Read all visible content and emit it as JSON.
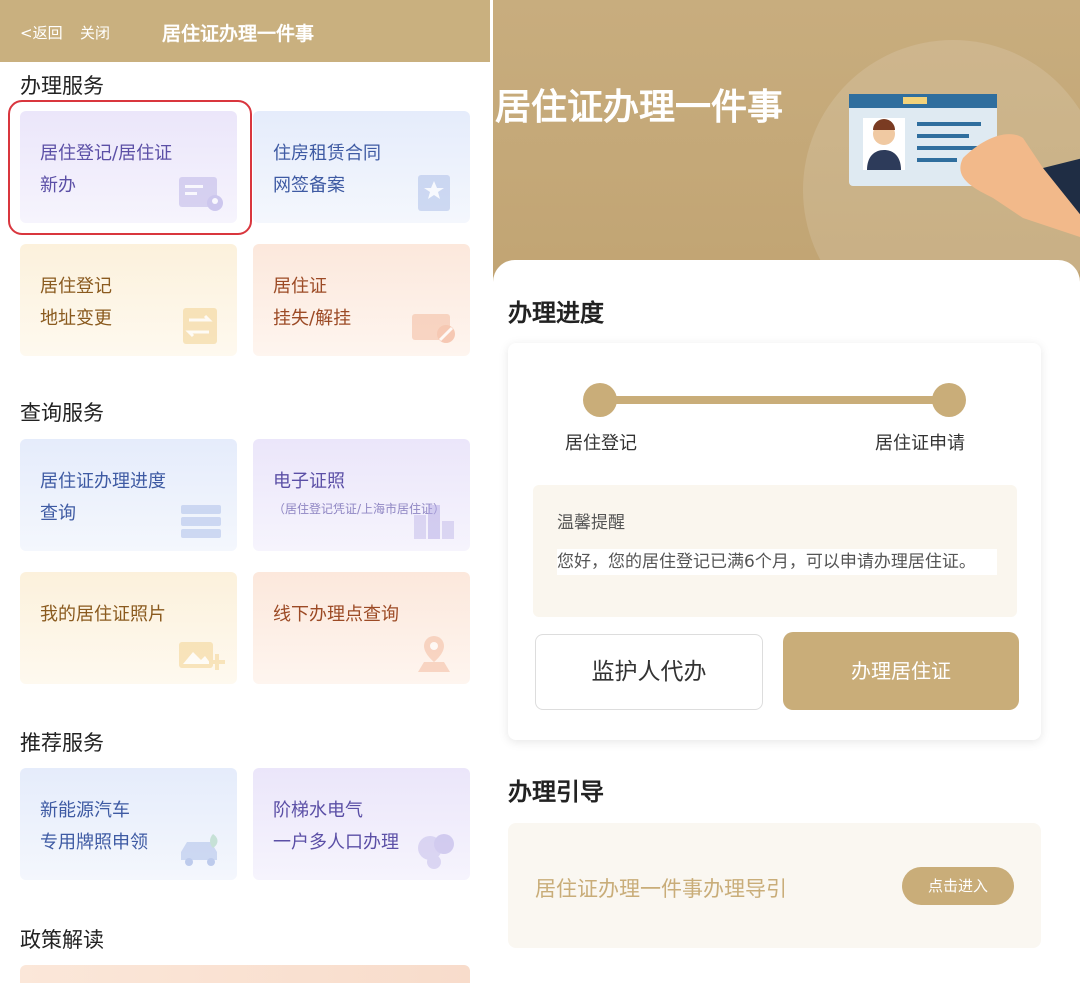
{
  "left": {
    "topbar": {
      "back": "<返回",
      "close": "关闭",
      "title": "居住证办理一件事"
    },
    "sections": {
      "handle": "办理服务",
      "query": "查询服务",
      "recommend": "推荐服务",
      "policy": "政策解读"
    },
    "cards": {
      "reg_new": {
        "l1": "居住登记/居住证",
        "l2": "新办",
        "icon": "id-card-icon"
      },
      "rental": {
        "l1": "住房租赁合同",
        "l2": "网签备案",
        "icon": "star-document-icon"
      },
      "address": {
        "l1": "居住登记",
        "l2": "地址变更",
        "icon": "swap-document-icon"
      },
      "lost": {
        "l1": "居住证",
        "l2": "挂失/解挂",
        "icon": "card-block-icon"
      },
      "progress_query": {
        "l1": "居住证办理进度",
        "l2": "查询",
        "icon": "list-icon"
      },
      "e_license": {
        "l1": "电子证照",
        "sub": "（居住登记凭证/上海市居住证）",
        "icon": "chart-icon"
      },
      "photo": {
        "l1": "我的居住证照片",
        "icon": "photo-add-icon"
      },
      "offline": {
        "l1": "线下办理点查询",
        "icon": "location-pin-icon"
      },
      "ev_plate": {
        "l1": "新能源汽车",
        "l2": "专用牌照申领",
        "icon": "car-icon"
      },
      "utility": {
        "l1": "阶梯水电气",
        "l2": "一户多人口办理",
        "icon": "water-drop-icon"
      }
    }
  },
  "right": {
    "banner_title": "居住证办理一件事",
    "progress": {
      "heading": "办理进度",
      "step1": "居住登记",
      "step2": "居住证申请",
      "tip_title": "温馨提醒",
      "tip_body": "您好，您的居住登记已满6个月，可以申请办理居住证。",
      "guardian_btn": "监护人代办",
      "apply_btn": "办理居住证"
    },
    "guide": {
      "heading": "办理引导",
      "title": "居住证办理一件事办理导引",
      "enter_btn": "点击进入"
    }
  },
  "colors": {
    "gold": "#c9ad79",
    "topbar": "#c9b07f",
    "highlight": "#d9363e"
  }
}
